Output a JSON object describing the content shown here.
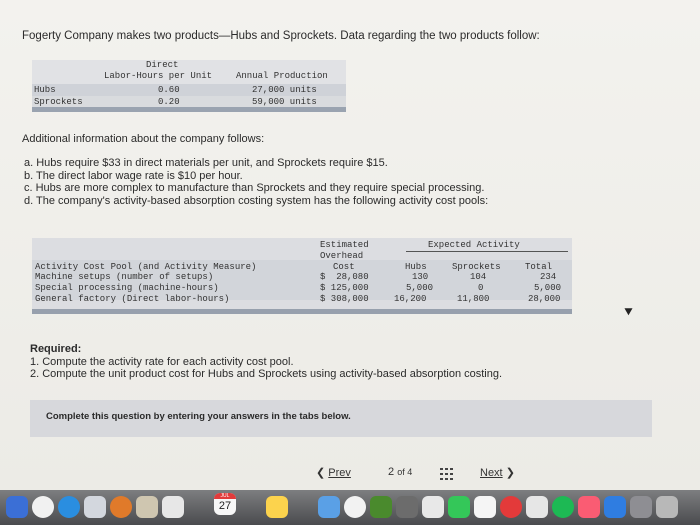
{
  "intro": "Fogerty Company makes two products—Hubs and Sprockets. Data regarding the two products follow:",
  "product_table": {
    "header_direct": "Direct",
    "header_labor": "Labor-Hours per Unit",
    "header_annual": "Annual Production",
    "rows": [
      {
        "name": "Hubs",
        "dlh": "0.60",
        "production": "27,000 units"
      },
      {
        "name": "Sprockets",
        "dlh": "0.20",
        "production": "59,000 units"
      }
    ]
  },
  "additional_heading": "Additional information about the company follows:",
  "info_items": [
    "a. Hubs require $33 in direct materials per unit, and Sprockets require $15.",
    "b. The direct labor wage rate is $10 per hour.",
    "c. Hubs are more complex to manufacture than Sprockets and they require special processing.",
    "d. The company's activity-based absorption costing system has the following activity cost pools:"
  ],
  "activity_table": {
    "col_pool": "Activity Cost Pool (and Activity Measure)",
    "col_est1": "Estimated",
    "col_est2": "Overhead",
    "col_est3": "Cost",
    "col_expected": "Expected Activity",
    "col_hubs": "Hubs",
    "col_sprockets": "Sprockets",
    "col_total": "Total",
    "rows": [
      {
        "pool": "Machine setups (number of setups)",
        "cost": "$  28,080",
        "hubs": "130",
        "sprockets": "104",
        "total": "234"
      },
      {
        "pool": "Special processing (machine-hours)",
        "cost": "$ 125,000",
        "hubs": "5,000",
        "sprockets": "0",
        "total": "5,000"
      },
      {
        "pool": "General factory (Direct labor-hours)",
        "cost": "$ 308,000",
        "hubs": "16,200",
        "sprockets": "11,800",
        "total": "28,000"
      }
    ]
  },
  "required": {
    "heading": "Required:",
    "items": [
      "1. Compute the activity rate for each activity cost pool.",
      "2. Compute the unit product cost for Hubs and Sprockets using activity-based absorption costing."
    ]
  },
  "complete_instruction": "Complete this question by entering your answers in the tabs below.",
  "pagination": {
    "prev": "Prev",
    "page": "2",
    "of": "of 4",
    "next": "Next"
  },
  "dock": {
    "calendar_day": "27",
    "calendar_month": "JUL"
  },
  "colors": {
    "page_bg": "#ecebe6",
    "table_bg": "#dcdde1",
    "table_bar": "#97a0ad",
    "instruction_bg": "#d7d8dc"
  }
}
